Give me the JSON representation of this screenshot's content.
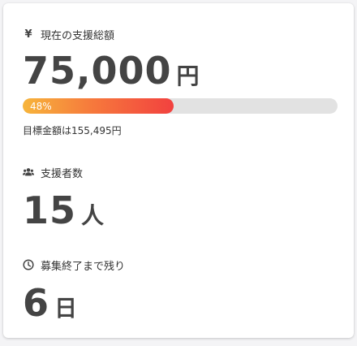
{
  "amount": {
    "icon": "yen-icon",
    "label": "現在の支援総額",
    "value": "75,000",
    "unit": "円"
  },
  "progress": {
    "percent": 48,
    "label": "48%",
    "goal_text": "目標金額は155,495円",
    "colors": [
      "#f7b53b",
      "#f2413f"
    ]
  },
  "supporters": {
    "icon": "users-icon",
    "label": "支援者数",
    "value": "15",
    "unit": "人"
  },
  "remaining": {
    "icon": "clock-icon",
    "label": "募集終了まで残り",
    "value": "6",
    "unit": "日"
  }
}
